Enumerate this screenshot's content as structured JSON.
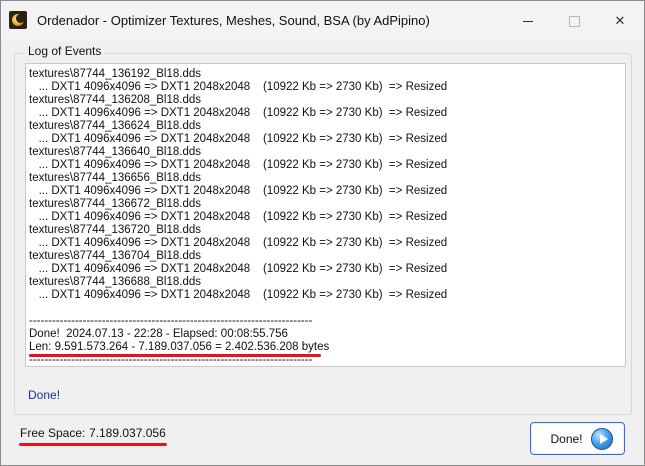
{
  "window": {
    "title": "Ordenador - Optimizer Textures, Meshes, Sound, BSA (by AdPipino)",
    "minimize_symbol": "—",
    "close_symbol": "✕"
  },
  "log": {
    "group_label": "Log of Events",
    "lines": [
      "textures\\87744_136192_Bl18.dds",
      "   ... DXT1 4096x4096 => DXT1 2048x2048    (10922 Kb => 2730 Kb)  => Resized",
      "textures\\87744_136208_Bl18.dds",
      "   ... DXT1 4096x4096 => DXT1 2048x2048    (10922 Kb => 2730 Kb)  => Resized",
      "textures\\87744_136624_Bl18.dds",
      "   ... DXT1 4096x4096 => DXT1 2048x2048    (10922 Kb => 2730 Kb)  => Resized",
      "textures\\87744_136640_Bl18.dds",
      "   ... DXT1 4096x4096 => DXT1 2048x2048    (10922 Kb => 2730 Kb)  => Resized",
      "textures\\87744_136656_Bl18.dds",
      "   ... DXT1 4096x4096 => DXT1 2048x2048    (10922 Kb => 2730 Kb)  => Resized",
      "textures\\87744_136672_Bl18.dds",
      "   ... DXT1 4096x4096 => DXT1 2048x2048    (10922 Kb => 2730 Kb)  => Resized",
      "textures\\87744_136720_Bl18.dds",
      "   ... DXT1 4096x4096 => DXT1 2048x2048    (10922 Kb => 2730 Kb)  => Resized",
      "textures\\87744_136704_Bl18.dds",
      "   ... DXT1 4096x4096 => DXT1 2048x2048    (10922 Kb => 2730 Kb)  => Resized",
      "textures\\87744_136688_Bl18.dds",
      "   ... DXT1 4096x4096 => DXT1 2048x2048    (10922 Kb => 2730 Kb)  => Resized",
      "",
      "--------------------------------------------------------------------------",
      "Done!  2024.07.13 - 22:28 - Elapsed: 00:08:55.756",
      "Len: 9.591.573.264 - 7.189.037.056 = 2.402.536.208 bytes",
      "--------------------------------------------------------------------------"
    ]
  },
  "status_text": "Done!",
  "free_space": {
    "label": "Free Space:",
    "value": "7.189.037.056"
  },
  "done_button_label": "Done!",
  "colors": {
    "highlight_underline": "#e8141c",
    "status_text": "#1e2f9c",
    "button_border": "#2f6fd0"
  }
}
